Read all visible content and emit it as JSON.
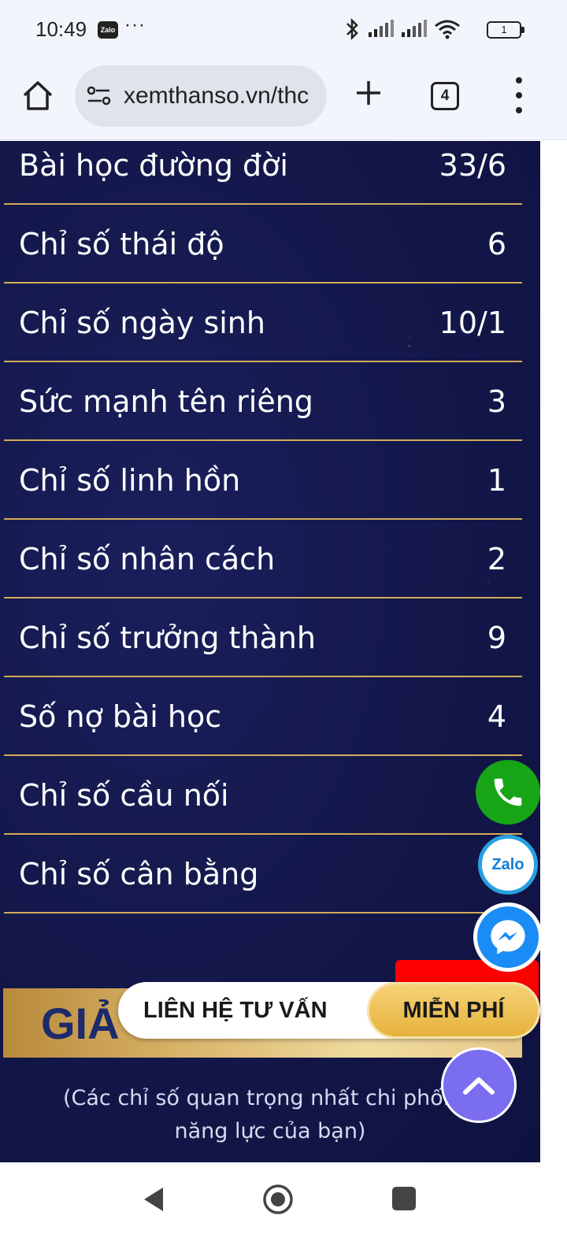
{
  "status_bar": {
    "time": "10:49",
    "notification_app": "Zalo",
    "more": "···",
    "battery": "1"
  },
  "browser": {
    "url": "xemthanso.vn/thc",
    "tab_count": "4"
  },
  "numerology": {
    "rows": [
      {
        "label": "Bài học đường đời",
        "value": "33/6"
      },
      {
        "label": "Chỉ số thái độ",
        "value": "6"
      },
      {
        "label": "Chỉ số ngày sinh",
        "value": "10/1"
      },
      {
        "label": "Sức mạnh tên riêng",
        "value": "3"
      },
      {
        "label": "Chỉ số linh hồn",
        "value": "1"
      },
      {
        "label": "Chỉ số nhân cách",
        "value": "2"
      },
      {
        "label": "Chỉ số trưởng thành",
        "value": "9"
      },
      {
        "label": "Số nợ bài học",
        "value": "4"
      },
      {
        "label": "Chỉ số cầu nối",
        "value": ""
      },
      {
        "label": "Chỉ số cân bằng",
        "value": ""
      }
    ],
    "banner_title": "GIẢ",
    "subtitle_line1": "(Các chỉ số quan trọng nhất chi phối to",
    "subtitle_line2": "năng lực của bạn)"
  },
  "cta": {
    "label": "LIÊN HỆ TƯ VẤN",
    "free": "MIỄN PHÍ"
  },
  "fab": {
    "zalo_text": "Zalo"
  },
  "colors": {
    "page_bg": "#131749",
    "divider": "#d4ab5a",
    "phone": "#17a517",
    "messenger": "#1a8cf5",
    "scroll_top": "#7a6df0",
    "cta_gold": "#e6b23c"
  }
}
